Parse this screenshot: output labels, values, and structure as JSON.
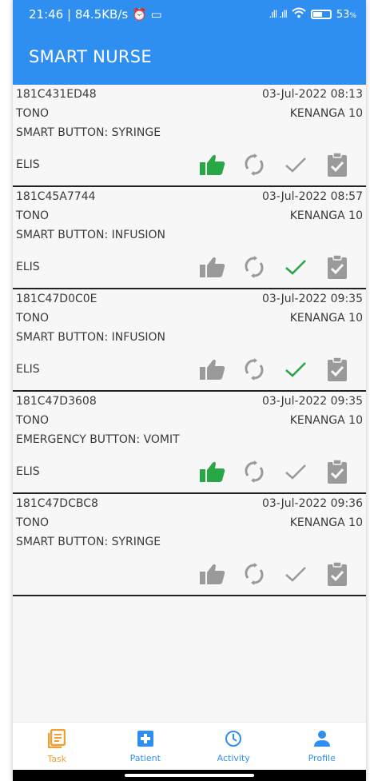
{
  "status_bar": {
    "time_info": "21:46 | 84.5KB/s",
    "signal": ".ıll .ıll",
    "battery": "53",
    "battery_unit": "%"
  },
  "app_title": "SMART NURSE",
  "colors": {
    "primary": "#2f8ff0",
    "active_tab": "#f0a030",
    "done_green": "#28a745",
    "inactive_gray": "#9a9a9a"
  },
  "tasks": [
    {
      "id": "181C431ED48",
      "datetime": "03-Jul-2022 08:13",
      "patient": "TONO",
      "room": "KENANGA 10",
      "type": "SMART BUTTON: SYRINGE",
      "nurse": "ELIS",
      "accepted": true,
      "done": false
    },
    {
      "id": "181C45A7744",
      "datetime": "03-Jul-2022 08:57",
      "patient": "TONO",
      "room": "KENANGA 10",
      "type": "SMART BUTTON: INFUSION",
      "nurse": "ELIS",
      "accepted": false,
      "done": true
    },
    {
      "id": "181C47D0C0E",
      "datetime": "03-Jul-2022 09:35",
      "patient": "TONO",
      "room": "KENANGA 10",
      "type": "SMART BUTTON: INFUSION",
      "nurse": "ELIS",
      "accepted": false,
      "done": true
    },
    {
      "id": "181C47D3608",
      "datetime": "03-Jul-2022 09:35",
      "patient": "TONO",
      "room": "KENANGA 10",
      "type": "EMERGENCY BUTTON: VOMIT",
      "nurse": "ELIS",
      "accepted": true,
      "done": false
    },
    {
      "id": "181C47DCBC8",
      "datetime": "03-Jul-2022 09:36",
      "patient": "TONO",
      "room": "KENANGA 10",
      "type": "SMART BUTTON: SYRINGE",
      "nurse": "",
      "accepted": false,
      "done": false
    }
  ],
  "nav": [
    {
      "label": "Task",
      "icon": "task-list-icon",
      "active": true
    },
    {
      "label": "Patient",
      "icon": "medical-cross-icon",
      "active": false
    },
    {
      "label": "Activity",
      "icon": "clock-icon",
      "active": false
    },
    {
      "label": "Profile",
      "icon": "person-icon",
      "active": false
    }
  ]
}
